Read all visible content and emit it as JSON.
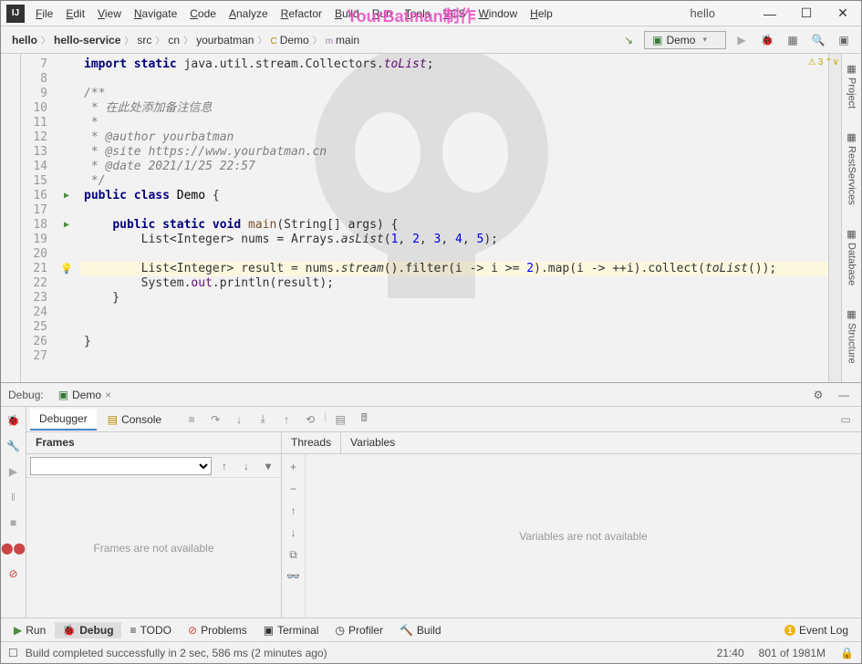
{
  "watermark": "YourBatman制作",
  "title": {
    "project": "hello"
  },
  "menu": [
    "File",
    "Edit",
    "View",
    "Navigate",
    "Code",
    "Analyze",
    "Refactor",
    "Build",
    "Run",
    "Tools",
    "VCS",
    "Window",
    "Help"
  ],
  "breadcrumbs": [
    "hello",
    "hello-service",
    "src",
    "cn",
    "yourbatman",
    "Demo",
    "main"
  ],
  "run_config": "Demo",
  "editor": {
    "warnings": "3",
    "lines_start": 7,
    "lines": [
      {
        "n": 7,
        "gutter": "",
        "html": "<span class='kw'>import static</span> java.util.stream.Collectors.<span class='static-m fld'>toList</span>;"
      },
      {
        "n": 8,
        "gutter": "",
        "html": ""
      },
      {
        "n": 9,
        "gutter": "",
        "html": "<span class='com'>/**</span>"
      },
      {
        "n": 10,
        "gutter": "",
        "html": "<span class='com'> * 在此处添加备注信息</span>"
      },
      {
        "n": 11,
        "gutter": "",
        "html": "<span class='com'> *</span>"
      },
      {
        "n": 12,
        "gutter": "",
        "html": "<span class='com'> * <span class='ann'>@author</span> yourbatman</span>"
      },
      {
        "n": 13,
        "gutter": "",
        "html": "<span class='com'> * <span class='ann'>@site</span> https://www.yourbatman.cn</span>"
      },
      {
        "n": 14,
        "gutter": "",
        "html": "<span class='com'> * <span class='ann'>@date</span> 2021/1/25 22:57</span>"
      },
      {
        "n": 15,
        "gutter": "",
        "html": "<span class='com'> */</span>"
      },
      {
        "n": 16,
        "gutter": "run",
        "html": "<span class='kw'>public class</span> <span class='cls'>Demo</span> {"
      },
      {
        "n": 17,
        "gutter": "",
        "html": ""
      },
      {
        "n": 18,
        "gutter": "run",
        "html": "    <span class='kw'>public static void</span> <span class='mtd'>main</span>(String[] <span class='param'>args</span>) {"
      },
      {
        "n": 19,
        "gutter": "",
        "html": "        List&lt;Integer&gt; <span class='param'>nums</span> = Arrays.<span class='static-m'>asList</span>(<span class='num'>1</span>, <span class='num'>2</span>, <span class='num'>3</span>, <span class='num'>4</span>, <span class='num'>5</span>);"
      },
      {
        "n": 20,
        "gutter": "",
        "html": ""
      },
      {
        "n": 21,
        "gutter": "bulb",
        "hl": true,
        "html": "        List&lt;Integer&gt; <span class='param'>result</span> = nums.<span class='static-m'>stream</span>().filter(i -&gt; i &gt;= <span class='num'>2</span>).map(i -&gt; ++i).collect(<span class='static-m'>toList</span>());"
      },
      {
        "n": 22,
        "gutter": "",
        "html": "        System.<span class='fld'>out</span>.println(<span class='param'>result</span>);"
      },
      {
        "n": 23,
        "gutter": "",
        "html": "    }"
      },
      {
        "n": 24,
        "gutter": "",
        "html": ""
      },
      {
        "n": 25,
        "gutter": "",
        "html": ""
      },
      {
        "n": 26,
        "gutter": "",
        "html": "}"
      },
      {
        "n": 27,
        "gutter": "",
        "html": ""
      }
    ]
  },
  "side_tabs": [
    "Project",
    "RestServices",
    "Database",
    "Structure"
  ],
  "debug": {
    "label": "Debug:",
    "config": "Demo",
    "tabs": {
      "debugger": "Debugger",
      "console": "Console"
    },
    "sub": {
      "frames": "Frames",
      "threads": "Threads",
      "variables": "Variables"
    },
    "frames_empty": "Frames are not available",
    "vars_empty": "Variables are not available"
  },
  "bottom_tabs": {
    "run": "Run",
    "debug": "Debug",
    "todo": "TODO",
    "problems": "Problems",
    "terminal": "Terminal",
    "profiler": "Profiler",
    "build": "Build",
    "event_log": "Event Log",
    "event_count": "1"
  },
  "status": {
    "msg": "Build completed successfully in 2 sec, 586 ms (2 minutes ago)",
    "pos": "21:40",
    "mem": "801 of 1981M"
  }
}
